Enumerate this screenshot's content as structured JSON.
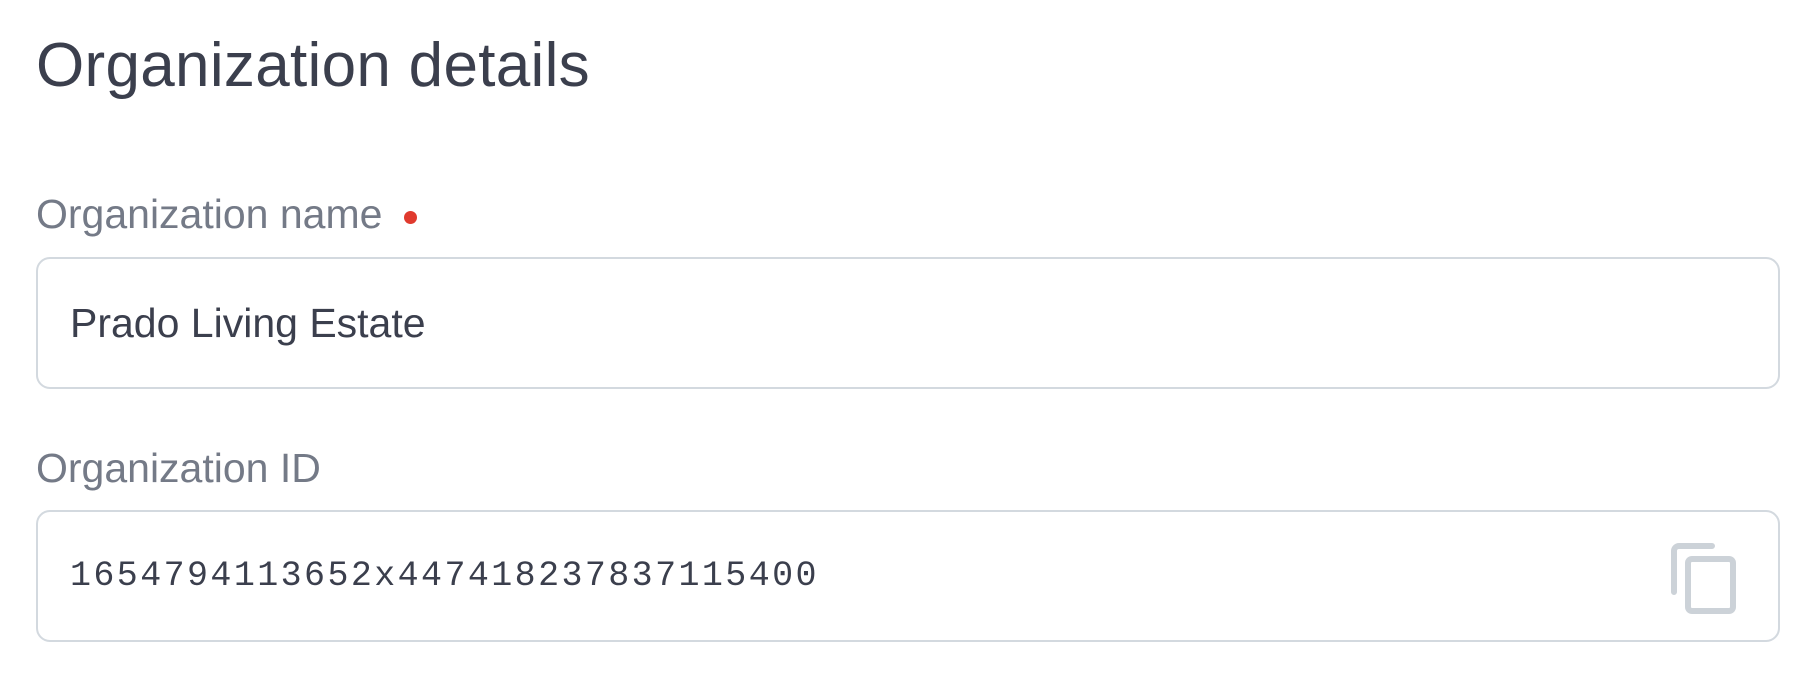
{
  "header": {
    "title": "Organization details"
  },
  "form": {
    "name": {
      "label": "Organization name",
      "value": "Prado Living Estate",
      "required": true
    },
    "id": {
      "label": "Organization ID",
      "value": "1654794113652x447418237837115400"
    }
  },
  "icons": {
    "copy": "copy-icon",
    "required": "required-indicator-dot"
  },
  "colors": {
    "title_text": "#3b3f4d",
    "label_text": "#747a87",
    "field_border": "#d3d9df",
    "required_dot": "#e03a2e",
    "icon": "#ccd2d8"
  }
}
